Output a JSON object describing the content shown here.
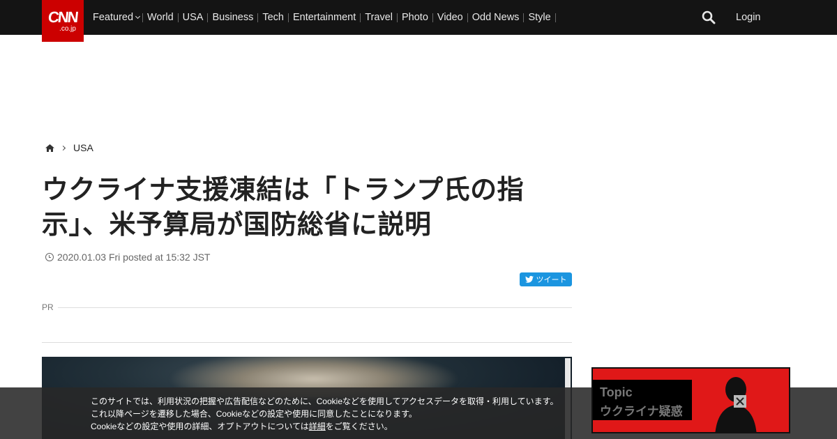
{
  "header": {
    "logo_main": "CNN",
    "logo_sub": ".co.jp",
    "nav": [
      {
        "label": "Featured",
        "dropdown": true
      },
      {
        "label": "World"
      },
      {
        "label": "USA"
      },
      {
        "label": "Business"
      },
      {
        "label": "Tech"
      },
      {
        "label": "Entertainment"
      },
      {
        "label": "Travel"
      },
      {
        "label": "Photo"
      },
      {
        "label": "Video"
      },
      {
        "label": "Odd News"
      },
      {
        "label": "Style"
      }
    ],
    "login": "Login"
  },
  "breadcrumb": {
    "section": "USA"
  },
  "article": {
    "title": "ウクライナ支援凍結は「トランプ氏の指示」、米予算局が国防総省に説明",
    "posted": "2020.01.03 Fri posted at 15:32 JST",
    "tweet_label": "ツイート",
    "pr_label": "PR"
  },
  "cookie": {
    "line1": "このサイトでは、利用状況の把握や広告配信などのために、Cookieなどを使用してアクセスデータを取得・利用しています。",
    "line2": "これ以降ページを遷移した場合、Cookieなどの設定や使用に同意したことになります。",
    "line3_pre": "Cookieなどの設定や使用の詳細、オプトアウトについては",
    "line3_link": "詳細",
    "line3_post": "をご覧ください。"
  },
  "topic": {
    "label": "Topic",
    "name": "ウクライナ疑惑"
  },
  "colors": {
    "brand": "#cc0000",
    "topbar": "#141414",
    "twitter": "#1b95e0"
  }
}
